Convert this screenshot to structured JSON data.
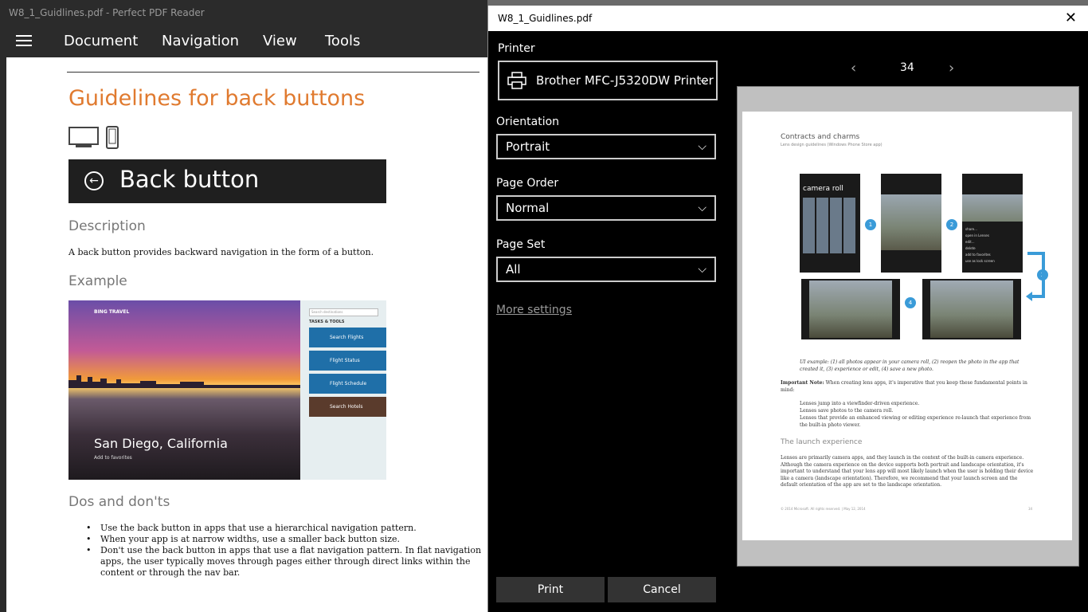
{
  "app": {
    "title": "W8_1_Guidlines.pdf - Perfect PDF Reader",
    "menu": [
      "Document",
      "Navigation",
      "View",
      "Tools"
    ]
  },
  "doc": {
    "title": "Guidelines for back buttons",
    "banner": "Back button",
    "description_heading": "Description",
    "description_text": "A back button provides backward navigation in the form of a button.",
    "example_heading": "Example",
    "example": {
      "app_name": "BING TRAVEL",
      "city": "San Diego, California",
      "favorites": "Add to favorites",
      "search_placeholder": "Search destinations",
      "tasks": "TASKS & TOOLS",
      "tiles": [
        "Search Flights",
        "Flight Status",
        "Flight Schedule",
        "Search Hotels"
      ]
    },
    "dos_heading": "Dos and don'ts",
    "dos": [
      "Use the back button in apps that use a hierarchical navigation pattern.",
      "When your app is at narrow widths, use a smaller back button size.",
      "Don't use the back button in apps that use a flat navigation pattern. In flat navigation apps, the user typically moves through pages either through direct links within the content or through the nav bar."
    ]
  },
  "dialog": {
    "title": "W8_1_Guidlines.pdf",
    "printer_label": "Printer",
    "printer_value": "Brother MFC-J5320DW Printer",
    "orientation_label": "Orientation",
    "orientation_value": "Portrait",
    "order_label": "Page Order",
    "order_value": "Normal",
    "set_label": "Page Set",
    "set_value": "All",
    "more_settings": "More settings",
    "page_number": "34",
    "print_button": "Print",
    "cancel_button": "Cancel"
  },
  "preview": {
    "heading": "Contracts and charms",
    "subheading": "Lens design guidelines (Windows Phone Store app)",
    "shot_title": "camera roll",
    "menu_items": [
      "share...",
      "open in Lenses",
      "edit...",
      "delete",
      "add to favorites",
      "use as lock screen"
    ],
    "caption": "UI example: (1) all photos appear in your camera roll, (2) reopen the photo in the app that created it, (3) experience or edit, (4) save a new photo.",
    "note_label": "Important Note:",
    "note": "When creating lens apps, it's imperative that you keep these fundamental points in mind:",
    "bullets": [
      "Lenses jump into a viewfinder-driven experience.",
      "Lenses save photos to the camera roll.",
      "Lenses that provide an enhanced viewing or editing experience re-launch that experience from the built-in photo viewer."
    ],
    "section": "The launch experience",
    "paragraph": "Lenses are primarily camera apps, and they launch in the context of the built-in camera experience. Although the camera experience on the device supports both portrait and landscape orientation, it's important to understand that your lens app will most likely launch when the user is holding their device like a camera (landscape orientation). Therefore, we recommend that your launch screen and the default orientation of the app are set to the landscape orientation.",
    "footer": "© 2014 Microsoft. All rights reserved. | May 12, 2014",
    "footer_page": "34",
    "badges": [
      "1",
      "2",
      "3",
      "4"
    ]
  }
}
